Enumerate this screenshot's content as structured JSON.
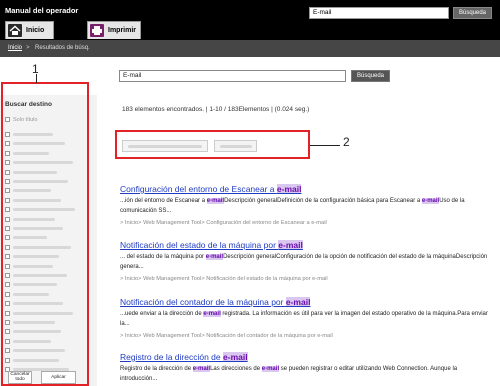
{
  "header": {
    "app_title": "Manual del operador",
    "search_value": "E-mail",
    "search_button": "Búsqueda",
    "tabs": [
      {
        "label": "Inicio",
        "icon": "home-icon"
      },
      {
        "label": "Imprimir",
        "icon": "printer-icon"
      }
    ]
  },
  "breadcrumb": {
    "home": "Inicio",
    "separator": ">",
    "current": "Resultados de búsq."
  },
  "sidebar": {
    "title": "Buscar destino",
    "only_title": "Solo título",
    "cancel_button": "Cancelar todo",
    "apply_button": "Aplicar"
  },
  "search": {
    "value": "E-mail",
    "button": "Búsqueda"
  },
  "summary": "183 elementos encontrados. | 1-10 / 183Elementos | (0.024 seg.)",
  "callouts": [
    "1",
    "2"
  ],
  "results": [
    {
      "title_pre": "Configuración del entorno de Escanear a ",
      "title_hl": "e-mail",
      "desc_1": "...ión del entorno de Escanear a ",
      "desc_hl1": "e-mail",
      "desc_2": "Descripción generalDefinición de la configuración básica para Escanear a ",
      "desc_hl2": "e-mail",
      "desc_3": "Uso de la comunicación SS...",
      "path": "> Inicio> Web Management Tool> Configuración del entorno de Escanear a e-mail"
    },
    {
      "title_pre": "Notificación del estado de la máquina por ",
      "title_hl": "e-mail",
      "desc_1": "... del estado de la máquina por ",
      "desc_hl1": "e-mail",
      "desc_2": "Descripción generalConfiguración de la opción de notificación del estado de la máquinaDescripción genera...",
      "path": "> Inicio> Web Management Tool> Notificación del estado de la máquina por e-mail"
    },
    {
      "title_pre": "Notificación del contador de la máquina por ",
      "title_hl": "e-mail",
      "desc_1": "...uede enviar a la dirección de ",
      "desc_hl1": "e-mail",
      "desc_2": " registrada. La información es útil para ver la imagen del estado operativo de la máquina.Para enviar la...",
      "path": "> Inicio> Web Management Tool> Notificación del contador de la máquina por e-mail"
    },
    {
      "title_pre": "Registro de la dirección de ",
      "title_hl": "e-mail",
      "desc_1": "Registro de la dirección de ",
      "desc_hl1": "e-mail",
      "desc_2": "Las direcciones de ",
      "desc_hl2": "e-mail",
      "desc_3": " se pueden registrar o editar utilizando Web Connection. Aunque la introducción..."
    }
  ]
}
